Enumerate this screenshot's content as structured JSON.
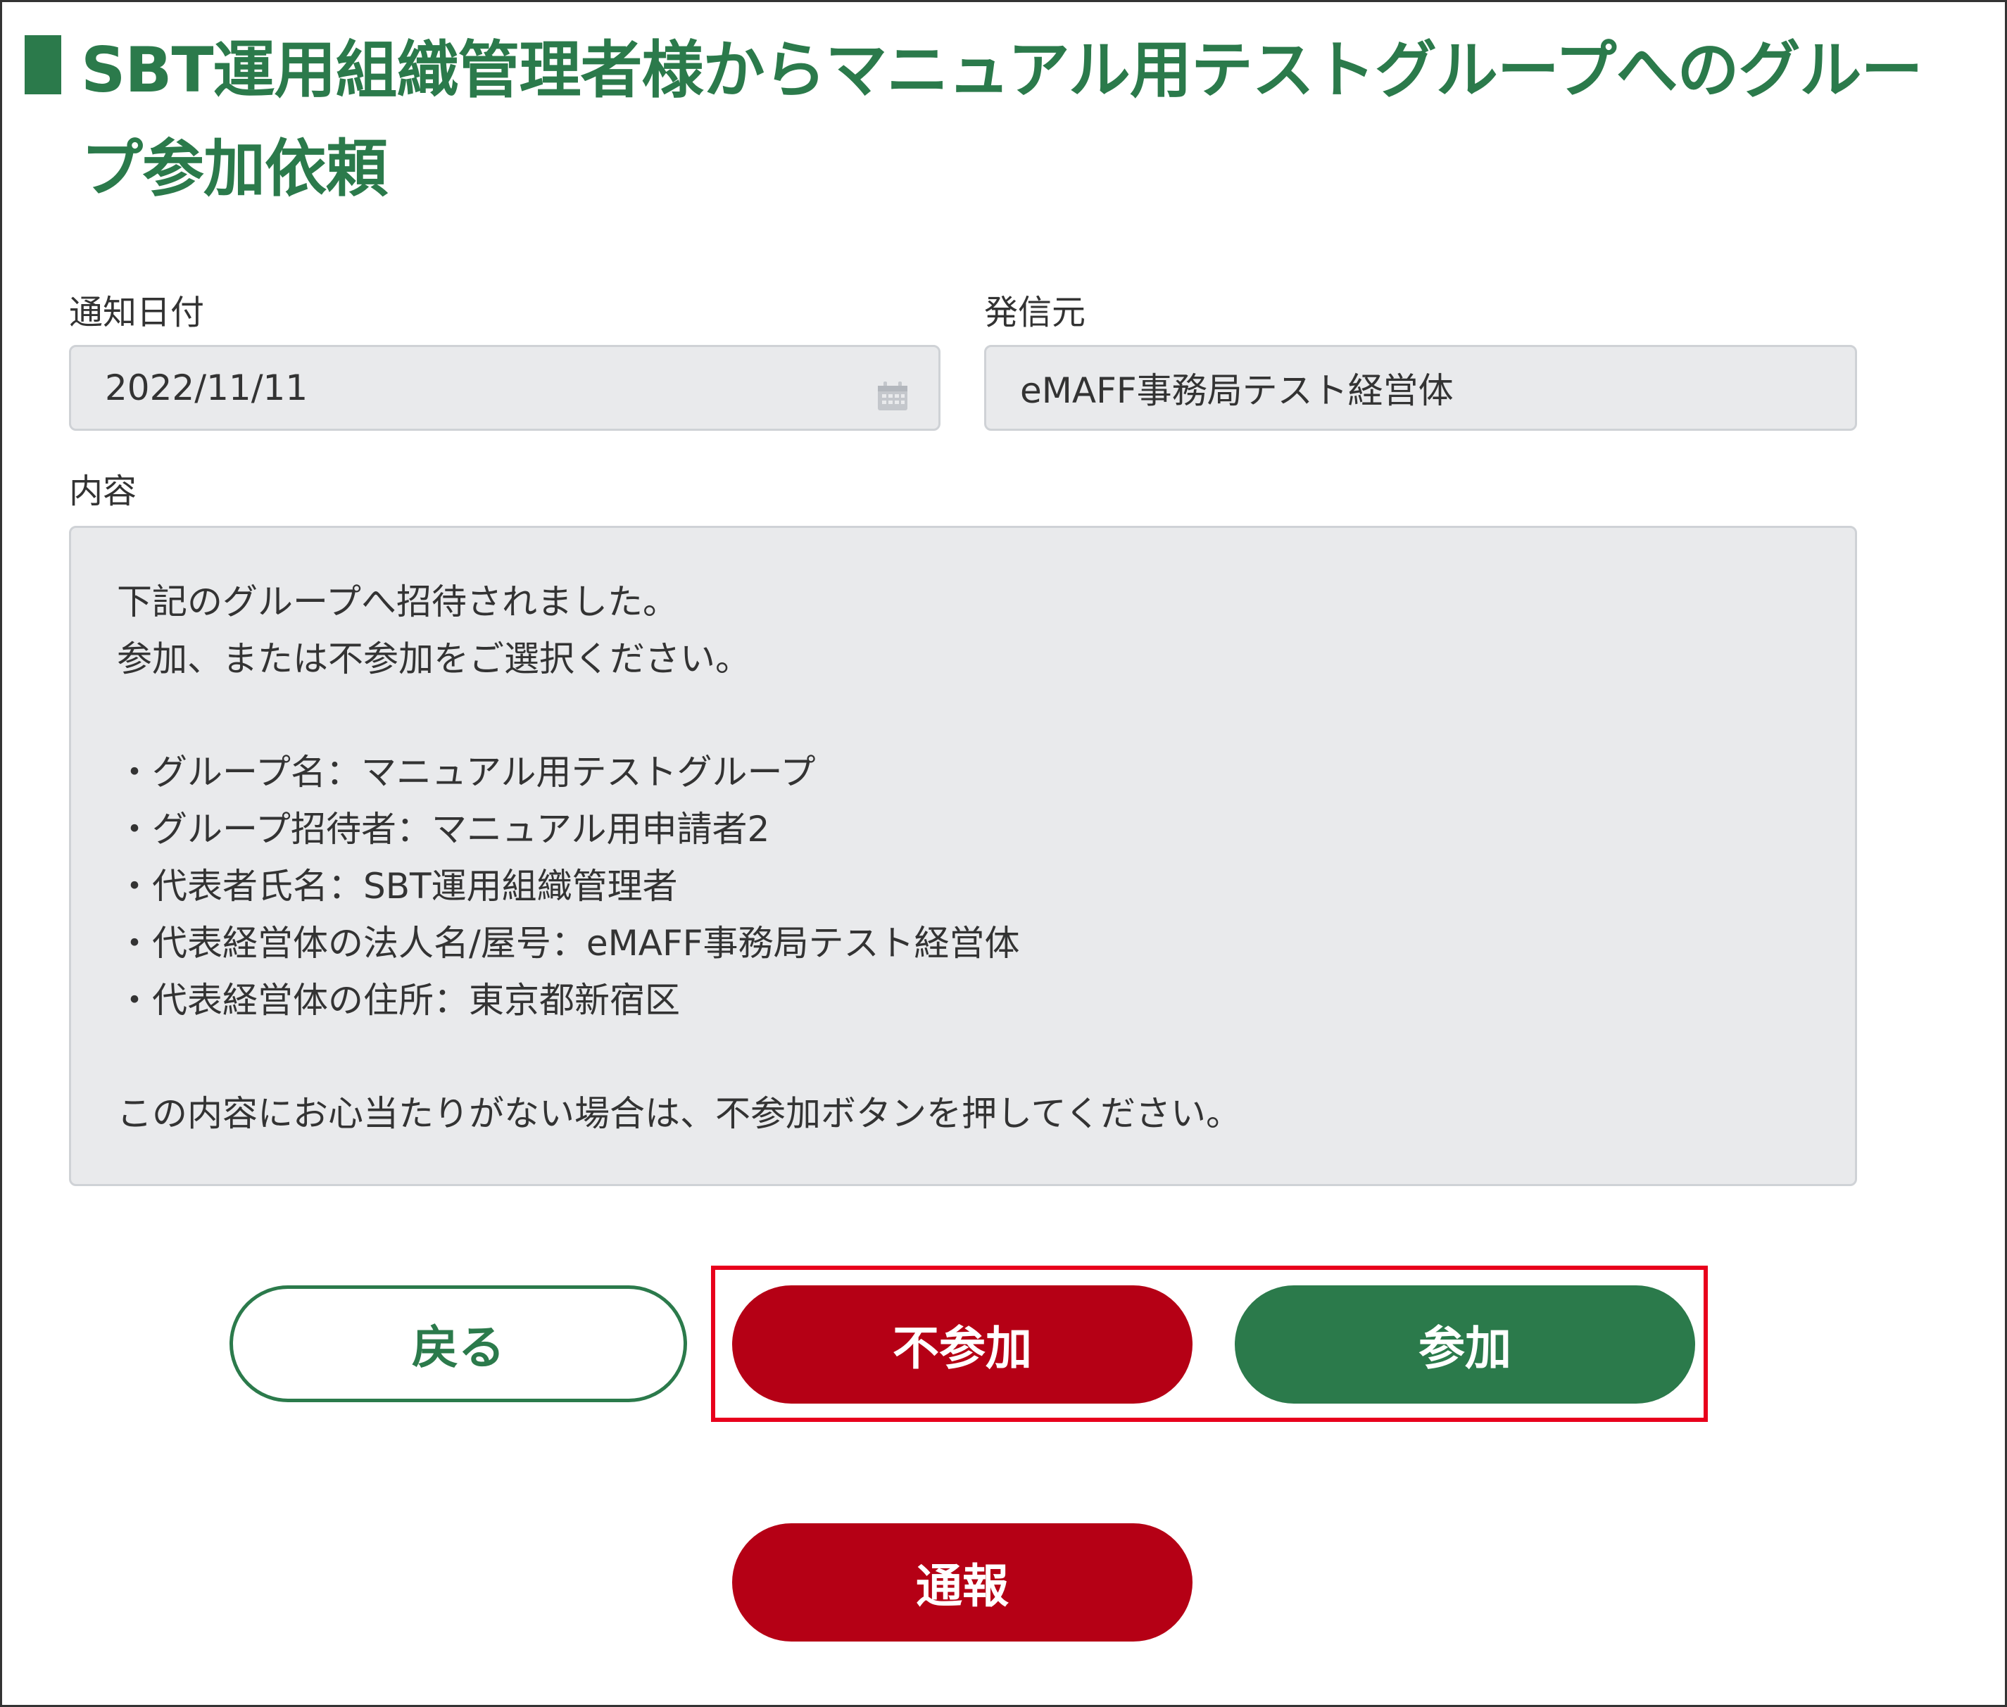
{
  "page": {
    "title": "SBT運用組織管理者様からマニュアル用テストグループへのグループ参加依頼"
  },
  "fields": {
    "date_label": "通知日付",
    "date_value": "2022/11/11",
    "sender_label": "発信元",
    "sender_value": "eMAFF事務局テスト経営体",
    "content_label": "内容"
  },
  "content": {
    "line1": "下記のグループへ招待されました。",
    "line2": "参加、または不参加をご選択ください。",
    "bullets": [
      "・グループ名：マニュアル用テストグループ",
      "・グループ招待者：マニュアル用申請者2",
      "・代表者氏名：SBT運用組織管理者",
      "・代表経営体の法人名/屋号：eMAFF事務局テスト経営体",
      "・代表経営体の住所：東京都新宿区"
    ],
    "footer": "この内容にお心当たりがない場合は、不参加ボタンを押してください。"
  },
  "buttons": {
    "back": "戻る",
    "decline": "不参加",
    "join": "参加",
    "report": "通報"
  },
  "colors": {
    "brand_green": "#2b7a4b",
    "danger_red": "#b50015",
    "highlight_red": "#e8001c",
    "field_bg": "#e9eaec"
  },
  "icons": {
    "date_field_icon": "calendar-icon"
  }
}
